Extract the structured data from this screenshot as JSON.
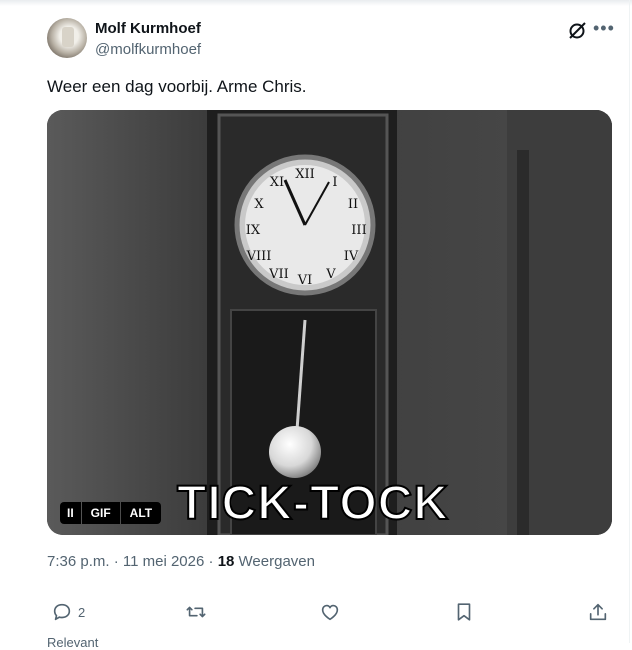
{
  "author": {
    "name": "Molf Kurmhoef",
    "handle": "@molfkurmhoef"
  },
  "tweet": {
    "text": "Weer een dag voorbij. Arme Chris."
  },
  "media": {
    "caption_text": "TICK-TOCK",
    "pause_label": "II",
    "gif_label": "GIF",
    "alt_label": "ALT"
  },
  "meta": {
    "time": "7:36 p.m.",
    "separator": "·",
    "date": "11 mei 2026",
    "views_count": "18",
    "views_label": "Weergaven"
  },
  "actions": {
    "reply_count": "2"
  },
  "footer": {
    "relevant_label": "Relevant"
  },
  "icons": {
    "grok": "grok-icon",
    "more": "more-icon",
    "reply": "reply-icon",
    "retweet": "retweet-icon",
    "like": "like-icon",
    "bookmark": "bookmark-icon",
    "share": "share-icon"
  }
}
